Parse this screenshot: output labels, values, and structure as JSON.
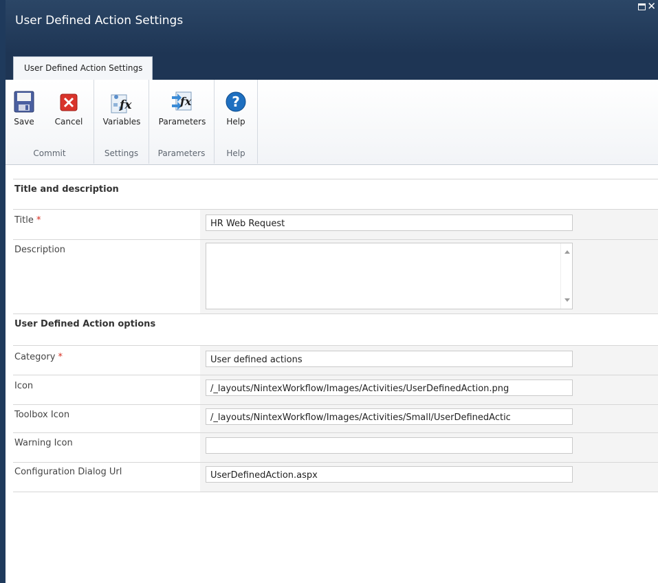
{
  "window": {
    "title": "User Defined Action Settings",
    "maximize_icon": "maximize-icon",
    "close_icon": "close-icon"
  },
  "tabs": [
    {
      "label": "User Defined Action Settings",
      "active": true
    }
  ],
  "ribbon": {
    "groups": [
      {
        "label": "Commit",
        "buttons": [
          {
            "label": "Save",
            "icon": "floppy-disk-icon"
          },
          {
            "label": "Cancel",
            "icon": "red-x-icon"
          }
        ]
      },
      {
        "label": "Settings",
        "buttons": [
          {
            "label": "Variables",
            "icon": "variables-fx-icon"
          }
        ]
      },
      {
        "label": "Parameters",
        "buttons": [
          {
            "label": "Parameters",
            "icon": "parameters-fx-icon"
          }
        ]
      },
      {
        "label": "Help",
        "buttons": [
          {
            "label": "Help",
            "icon": "help-question-icon"
          }
        ]
      }
    ]
  },
  "form": {
    "section1_title": "Title and description",
    "title_label": "Title",
    "title_value": "HR Web Request",
    "description_label": "Description",
    "description_value": "",
    "section2_title": "User Defined Action options",
    "category_label": "Category",
    "category_value": "User defined actions",
    "icon_label": "Icon",
    "icon_value": "/_layouts/NintexWorkflow/Images/Activities/UserDefinedAction.png",
    "toolbox_icon_label": "Toolbox Icon",
    "toolbox_icon_value": "/_layouts/NintexWorkflow/Images/Activities/Small/UserDefinedActic",
    "warning_icon_label": "Warning Icon",
    "warning_icon_value": "",
    "config_dialog_label": "Configuration Dialog Url",
    "config_dialog_value": "UserDefinedAction.aspx",
    "required_marker": "*"
  },
  "colors": {
    "titlebar": "#1e3554",
    "required": "#d52b1e",
    "help_blue": "#1e6fc0",
    "cancel_red": "#d9342b"
  }
}
